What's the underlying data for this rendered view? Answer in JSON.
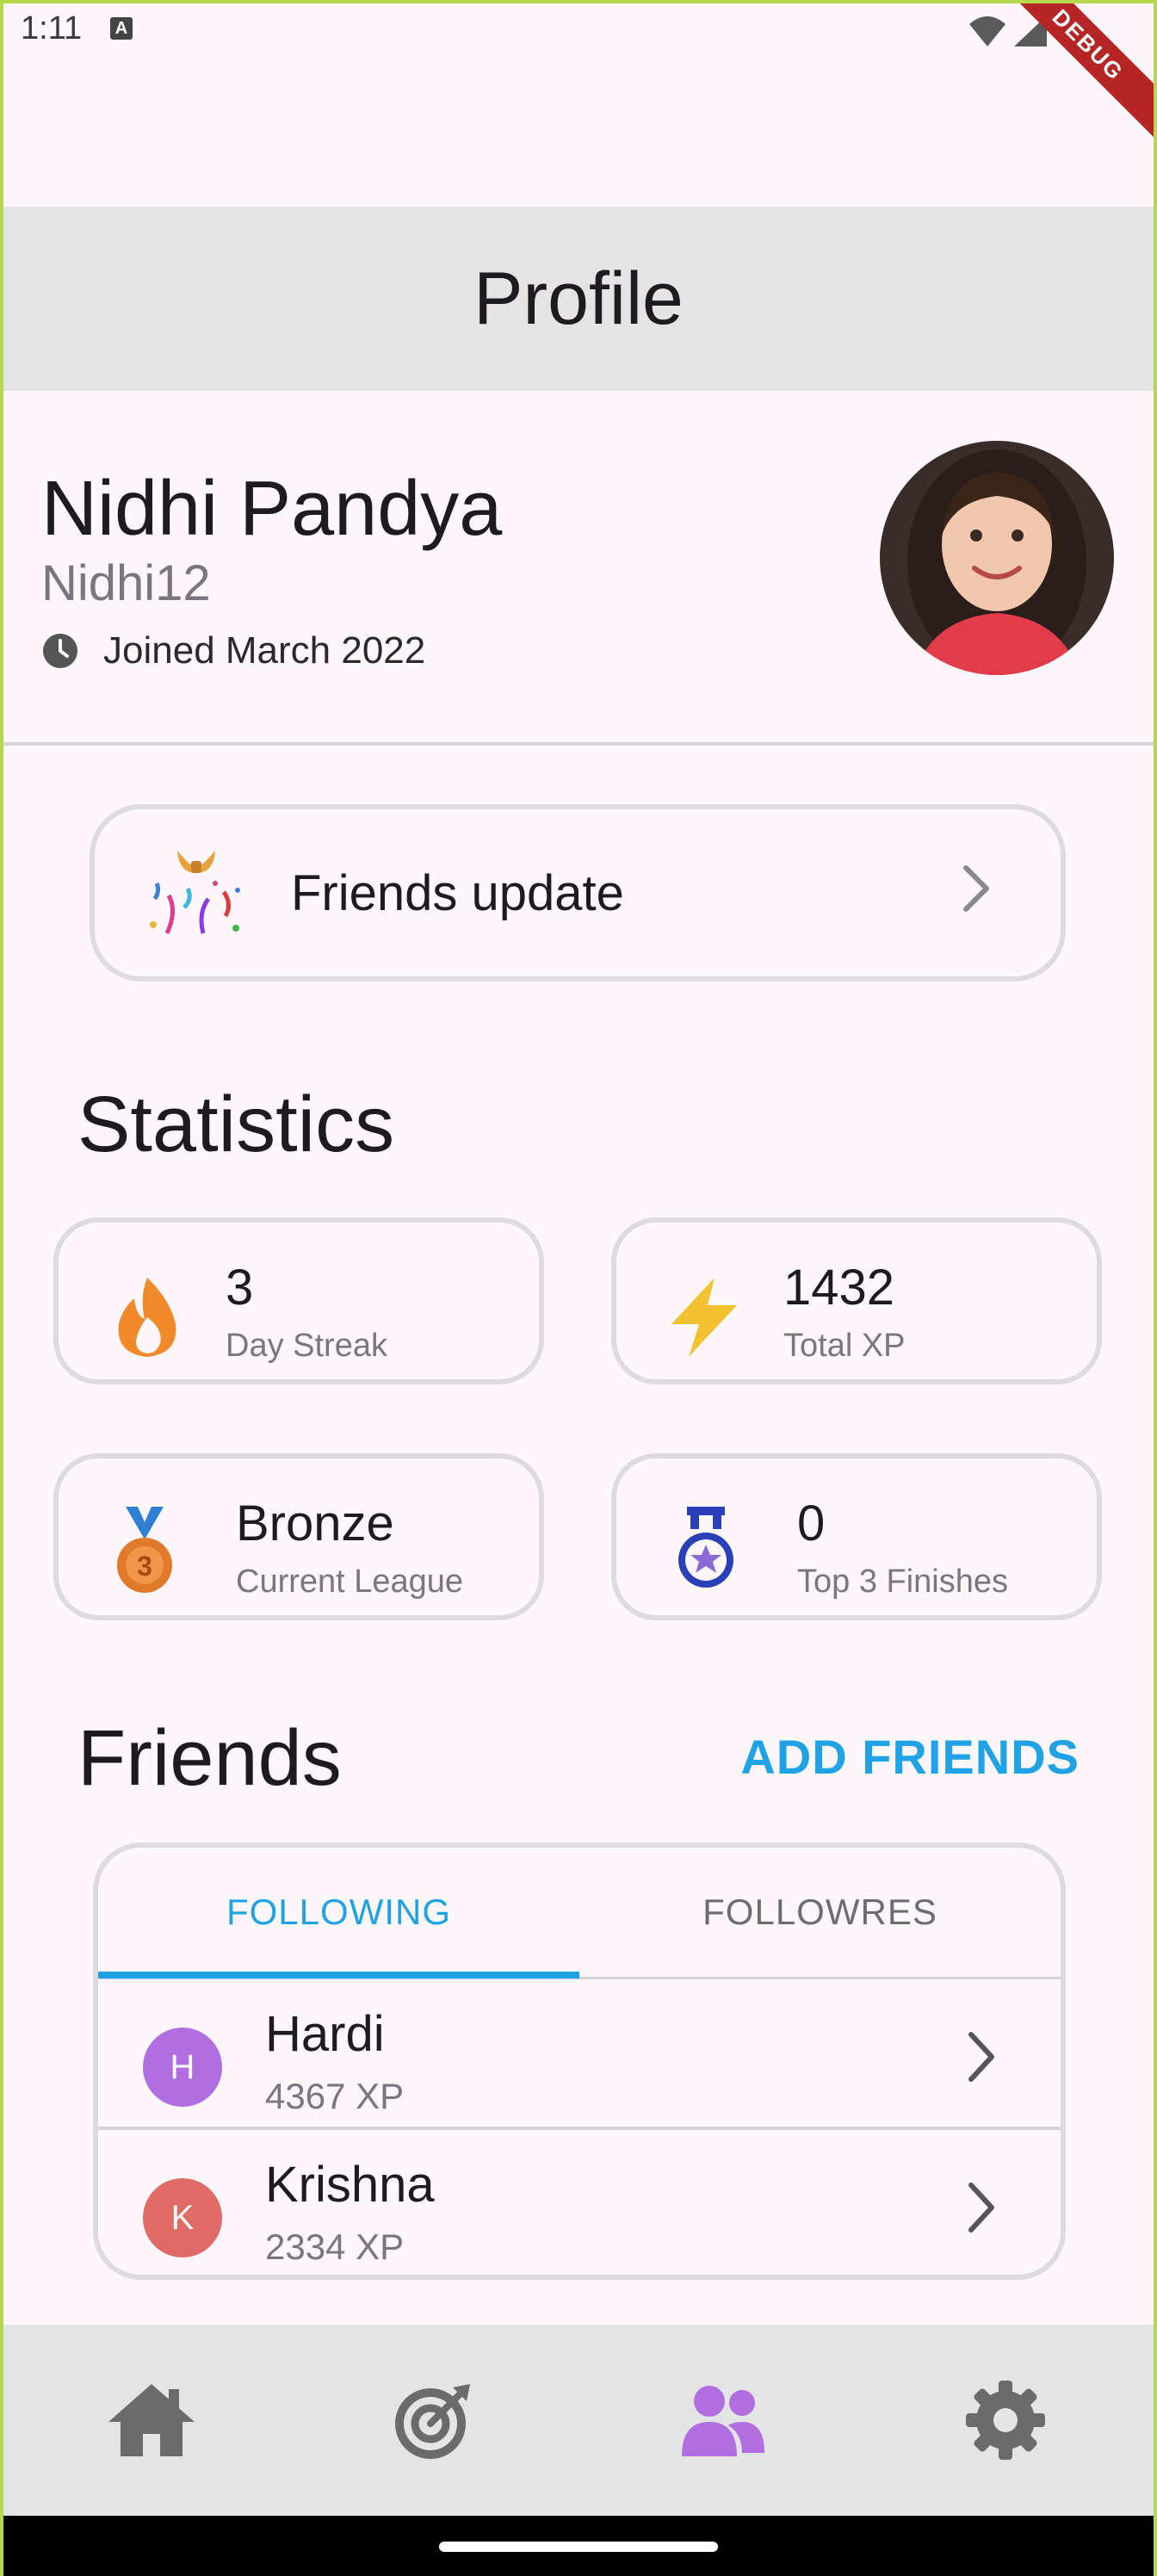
{
  "status_bar": {
    "time": "1:11",
    "notification_badge": "A",
    "debug_label": "DEBUG"
  },
  "app_bar": {
    "title": "Profile"
  },
  "profile": {
    "name": "Nidhi Pandya",
    "username": "Nidhi12",
    "joined": "Joined March 2022"
  },
  "friends_update": {
    "label": "Friends update"
  },
  "statistics": {
    "title": "Statistics",
    "cards": [
      {
        "icon": "fire-icon",
        "value": "3",
        "label": "Day Streak"
      },
      {
        "icon": "lightning-icon",
        "value": "1432",
        "label": "Total XP"
      },
      {
        "icon": "bronze-medal-icon",
        "value": "Bronze",
        "label": "Current League"
      },
      {
        "icon": "medal-icon",
        "value": "0",
        "label": "Top 3 Finishes"
      }
    ]
  },
  "friends": {
    "title": "Friends",
    "add_button": "ADD FRIENDS",
    "tabs": [
      {
        "label": "FOLLOWING",
        "active": true
      },
      {
        "label": "FOLLOWRES",
        "active": false
      }
    ],
    "list": [
      {
        "initial": "H",
        "name": "Hardi",
        "xp": "4367 XP",
        "color": "#b06ee0"
      },
      {
        "initial": "K",
        "name": "Krishna",
        "xp": "2334 XP",
        "color": "#e06a66"
      }
    ]
  },
  "bottom_nav": {
    "items": [
      {
        "icon": "home-icon",
        "active": false
      },
      {
        "icon": "target-icon",
        "active": false
      },
      {
        "icon": "friends-icon",
        "active": true
      },
      {
        "icon": "settings-icon",
        "active": false
      }
    ],
    "active_color": "#b06ee0",
    "inactive_color": "#6b6b6b"
  },
  "colors": {
    "accent": "#1fa3e6",
    "background": "#fdf7fb",
    "app_bar": "#e4e4e4"
  }
}
